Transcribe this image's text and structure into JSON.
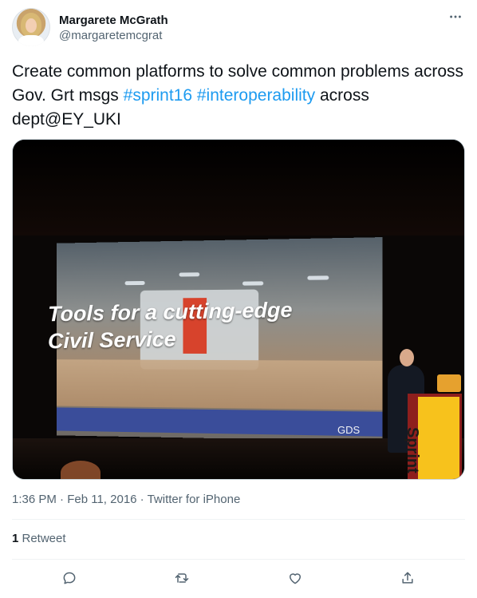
{
  "author": {
    "name": "Margarete McGrath",
    "handle": "@margaretemcgrat"
  },
  "tweet": {
    "text_plain_1": "Create common platforms to solve common problems across Gov. Grt msgs ",
    "hashtag_1": "#sprint16",
    "hashtag_2": "#interoperability",
    "text_plain_2": " across dept@EY_UKI"
  },
  "media": {
    "slide_title_line1": "Tools for a cutting-edge",
    "slide_title_line2": "Civil Service",
    "slide_footer": "GDS",
    "banner_text": "Sprint"
  },
  "meta": {
    "time": "1:36 PM",
    "separator": " · ",
    "date": "Feb 11, 2016",
    "source": "Twitter for iPhone"
  },
  "stats": {
    "retweet_count": "1",
    "retweet_label": " Retweet"
  },
  "icons": {
    "more": "more-icon",
    "reply": "reply-icon",
    "retweet": "retweet-icon",
    "like": "like-icon",
    "share": "share-icon"
  },
  "colors": {
    "hashtag": "#1d9bf0",
    "secondary_text": "#536471",
    "primary_text": "#0f1419"
  }
}
